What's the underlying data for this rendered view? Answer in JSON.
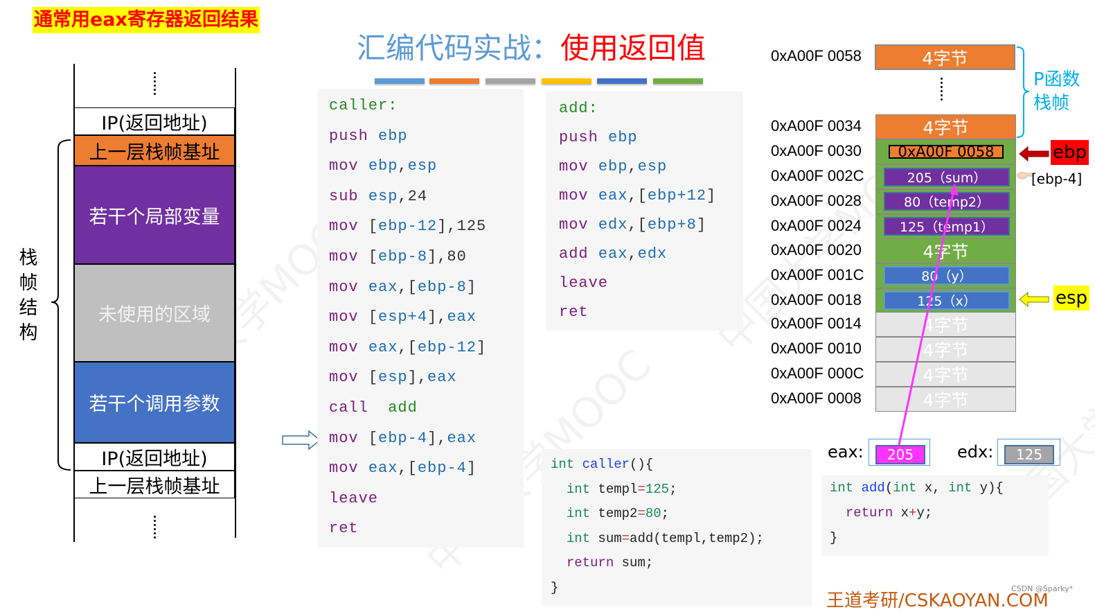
{
  "banner": "通常用eax寄存器返回结果",
  "title": {
    "part1": "汇编代码实战：",
    "part2": "使用返回值"
  },
  "color_bars": [
    "#5b9bd5",
    "#ed7d31",
    "#a5a5a5",
    "#ffc000",
    "#4472c4",
    "#70ad47"
  ],
  "left_stack": {
    "frame_label": [
      "栈",
      "帧",
      "结",
      "构"
    ],
    "cells": [
      {
        "label": "IP(返回地址)",
        "color": "#ffffff",
        "text_color": "#000000"
      },
      {
        "label": "上一层栈帧基址",
        "color": "#ed7d31",
        "text_color": "#000000"
      },
      {
        "label": "若干个局部变量",
        "color": "#7030a0",
        "text_color": "#ffffff"
      },
      {
        "label": "未使用的区域",
        "color": "#bfbfbf",
        "text_color": "#f2f2f2"
      },
      {
        "label": "若干个调用参数",
        "color": "#4472c4",
        "text_color": "#ffffff"
      },
      {
        "label": "IP(返回地址)",
        "color": "#ffffff",
        "text_color": "#000000"
      },
      {
        "label": "上一层栈帧基址",
        "color": "#ffffff",
        "text_color": "#000000"
      }
    ]
  },
  "caller_asm": [
    [
      [
        "lbl",
        "caller:"
      ]
    ],
    [
      [
        "kw",
        "push "
      ],
      [
        "reg",
        "ebp"
      ]
    ],
    [
      [
        "kw",
        "mov "
      ],
      [
        "reg",
        "ebp"
      ],
      [
        "num",
        ","
      ],
      [
        "reg",
        "esp"
      ]
    ],
    [
      [
        "kw",
        "sub "
      ],
      [
        "reg",
        "esp"
      ],
      [
        "num",
        ",24"
      ]
    ],
    [
      [
        "kw",
        "mov "
      ],
      [
        "num",
        "["
      ],
      [
        "reg",
        "ebp-12"
      ],
      [
        "num",
        "],125"
      ]
    ],
    [
      [
        "kw",
        "mov "
      ],
      [
        "num",
        "["
      ],
      [
        "reg",
        "ebp-8"
      ],
      [
        "num",
        "],80"
      ]
    ],
    [
      [
        "kw",
        "mov "
      ],
      [
        "reg",
        "eax"
      ],
      [
        "num",
        ",["
      ],
      [
        "reg",
        "ebp-8"
      ],
      [
        "num",
        "]"
      ]
    ],
    [
      [
        "kw",
        "mov "
      ],
      [
        "num",
        "["
      ],
      [
        "reg",
        "esp+4"
      ],
      [
        "num",
        "],"
      ],
      [
        "reg",
        "eax"
      ]
    ],
    [
      [
        "kw",
        "mov "
      ],
      [
        "reg",
        "eax"
      ],
      [
        "num",
        ",["
      ],
      [
        "reg",
        "ebp-12"
      ],
      [
        "num",
        "]"
      ]
    ],
    [
      [
        "kw",
        "mov "
      ],
      [
        "num",
        "["
      ],
      [
        "reg",
        "esp"
      ],
      [
        "num",
        "],"
      ],
      [
        "reg",
        "eax"
      ]
    ],
    [
      [
        "kw",
        "call  "
      ],
      [
        "lbl",
        "add"
      ]
    ],
    [
      [
        "kw",
        "mov "
      ],
      [
        "num",
        "["
      ],
      [
        "reg",
        "ebp-4"
      ],
      [
        "num",
        "],"
      ],
      [
        "reg",
        "eax"
      ]
    ],
    [
      [
        "kw",
        "mov "
      ],
      [
        "reg",
        "eax"
      ],
      [
        "num",
        ",["
      ],
      [
        "reg",
        "ebp-4"
      ],
      [
        "num",
        "]"
      ]
    ],
    [
      [
        "kw",
        "leave"
      ]
    ],
    [
      [
        "kw",
        "ret"
      ]
    ]
  ],
  "current_instruction_index": 11,
  "add_asm": [
    [
      [
        "lbl",
        "add:"
      ]
    ],
    [
      [
        "kw",
        "push "
      ],
      [
        "reg",
        "ebp"
      ]
    ],
    [
      [
        "kw",
        "mov "
      ],
      [
        "reg",
        "ebp"
      ],
      [
        "num",
        ","
      ],
      [
        "reg",
        "esp"
      ]
    ],
    [
      [
        "kw",
        "mov "
      ],
      [
        "reg",
        "eax"
      ],
      [
        "num",
        ",["
      ],
      [
        "reg",
        "ebp+12"
      ],
      [
        "num",
        "]"
      ]
    ],
    [
      [
        "kw",
        "mov "
      ],
      [
        "reg",
        "edx"
      ],
      [
        "num",
        ",["
      ],
      [
        "reg",
        "ebp+8"
      ],
      [
        "num",
        "]"
      ]
    ],
    [
      [
        "kw",
        "add "
      ],
      [
        "reg",
        "eax"
      ],
      [
        "num",
        ","
      ],
      [
        "reg",
        "edx"
      ]
    ],
    [
      [
        "kw",
        "leave"
      ]
    ],
    [
      [
        "kw",
        "ret"
      ]
    ]
  ],
  "caller_c": [
    [
      [
        "ct",
        "int "
      ],
      [
        "cf",
        "caller"
      ],
      [
        "",
        "(){"
      ]
    ],
    [
      [
        "",
        "  "
      ],
      [
        "ct",
        "int "
      ],
      [
        "",
        "templ"
      ],
      [
        "ceq",
        "="
      ],
      [
        "cn",
        "125"
      ],
      [
        "",
        ";"
      ]
    ],
    [
      [
        "",
        "  "
      ],
      [
        "ct",
        "int "
      ],
      [
        "",
        "temp2"
      ],
      [
        "ceq",
        "="
      ],
      [
        "cn",
        "80"
      ],
      [
        "",
        ";"
      ]
    ],
    [
      [
        "",
        "  "
      ],
      [
        "ct",
        "int "
      ],
      [
        "",
        "sum"
      ],
      [
        "ceq",
        "="
      ],
      [
        "",
        "add(templ,temp2);"
      ]
    ],
    [
      [
        "",
        "  "
      ],
      [
        "cr",
        "return "
      ],
      [
        "",
        "sum;"
      ]
    ],
    [
      [
        "",
        "}"
      ]
    ]
  ],
  "add_c": [
    [
      [
        "ct",
        "int "
      ],
      [
        "cf",
        "add"
      ],
      [
        "",
        "("
      ],
      [
        "ct",
        "int "
      ],
      [
        "",
        "x, "
      ],
      [
        "ct",
        "int "
      ],
      [
        "",
        "y){"
      ]
    ],
    [
      [
        "",
        "  "
      ],
      [
        "cr",
        "return "
      ],
      [
        "",
        "x"
      ],
      [
        "ceq",
        "+"
      ],
      [
        "",
        "y;"
      ]
    ],
    [
      [
        "",
        "}"
      ]
    ]
  ],
  "memory": {
    "rows": [
      {
        "addr": "0xA00F 0058",
        "label": "4字节",
        "bg": "#ed7d31"
      },
      {
        "addr": "0xA00F 0034",
        "label": "4字节",
        "bg": "#ed7d31"
      },
      {
        "addr": "0xA00F 0030",
        "label": "0xA00F 0058",
        "bg": "#70ad47",
        "inner_bg": "#ed7d31",
        "inner_color": "#000000"
      },
      {
        "addr": "0xA00F 002C",
        "label": "205（sum）",
        "bg": "#70ad47",
        "inner_bg": "#7030a0",
        "inner_color": "#ffffff"
      },
      {
        "addr": "0xA00F 0028",
        "label": "80（temp2）",
        "bg": "#70ad47",
        "inner_bg": "#7030a0",
        "inner_color": "#ffffff"
      },
      {
        "addr": "0xA00F 0024",
        "label": "125（temp1）",
        "bg": "#70ad47",
        "inner_bg": "#7030a0",
        "inner_color": "#ffffff"
      },
      {
        "addr": "0xA00F 0020",
        "label": "4字节",
        "bg": "#70ad47"
      },
      {
        "addr": "0xA00F 001C",
        "label": "80（y）",
        "bg": "#70ad47",
        "inner_bg": "#4472c4",
        "inner_color": "#ffffff"
      },
      {
        "addr": "0xA00F 0018",
        "label": "125（x）",
        "bg": "#70ad47",
        "inner_bg": "#4472c4",
        "inner_color": "#ffffff"
      },
      {
        "addr": "0xA00F 0014",
        "label": "4字节",
        "bg": "#e7e6e6"
      },
      {
        "addr": "0xA00F 0010",
        "label": "4字节",
        "bg": "#e7e6e6"
      },
      {
        "addr": "0xA00F 000C",
        "label": "4字节",
        "bg": "#e7e6e6"
      },
      {
        "addr": "0xA00F 0008",
        "label": "4字节",
        "bg": "#e7e6e6"
      }
    ],
    "frame_brace_label": "P函数栈帧",
    "frame_brace_label_lines": [
      "P函数",
      "栈帧"
    ],
    "ebp_label": "ebp",
    "esp_label": "esp",
    "ebp_minus4_label": "[ebp-4]"
  },
  "registers": {
    "eax": {
      "label": "eax:",
      "value": "205",
      "color": "#ff33ff"
    },
    "edx": {
      "label": "edx:",
      "value": "125",
      "color": "#a5a5a5"
    }
  },
  "footer": {
    "brand": "王道考研/CSKAOYAN.COM",
    "credit": "CSDN @Sparky*"
  },
  "watermark": "中国大学MOOC"
}
